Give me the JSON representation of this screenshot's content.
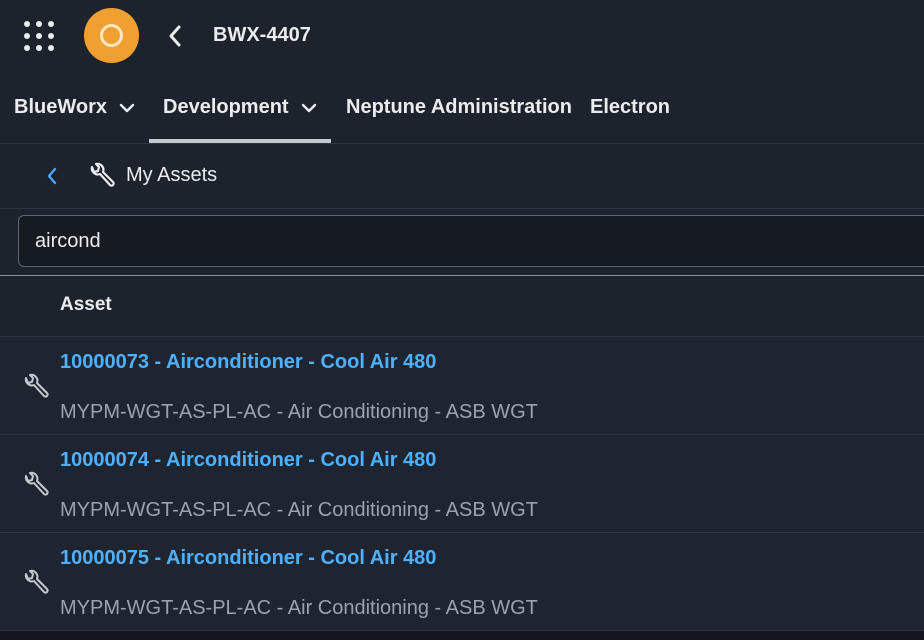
{
  "shell": {
    "title": "BWX-4407",
    "launcher_icon": "grid-icon",
    "back_icon": "chevron-left-icon",
    "logo_color": "#f0a030"
  },
  "nav": {
    "tabs": [
      {
        "label": "BlueWorx",
        "has_dropdown": true,
        "active": false
      },
      {
        "label": "Development",
        "has_dropdown": true,
        "active": true
      },
      {
        "label": "Neptune Administration",
        "has_dropdown": false,
        "active": false
      },
      {
        "label": "Electron",
        "has_dropdown": false,
        "active": false
      }
    ]
  },
  "subheader": {
    "back_icon": "chevron-left-icon",
    "icon": "wrench-icon",
    "title": "My Assets"
  },
  "search": {
    "value": "aircond"
  },
  "table": {
    "column_header": "Asset",
    "rows": [
      {
        "title": "10000073 - Airconditioner - Cool Air 480",
        "subtitle": "MYPM-WGT-AS-PL-AC - Air Conditioning - ASB WGT",
        "icon": "wrench-icon"
      },
      {
        "title": "10000074 - Airconditioner - Cool Air 480",
        "subtitle": "MYPM-WGT-AS-PL-AC - Air Conditioning - ASB WGT",
        "icon": "wrench-icon"
      },
      {
        "title": "10000075 - Airconditioner - Cool Air 480",
        "subtitle": "MYPM-WGT-AS-PL-AC - Air Conditioning - ASB WGT",
        "icon": "wrench-icon"
      }
    ]
  },
  "colors": {
    "background": "#1d232c",
    "link": "#4db1ff",
    "accent_back": "#4da3ff",
    "muted_text": "#9aa3ad"
  }
}
